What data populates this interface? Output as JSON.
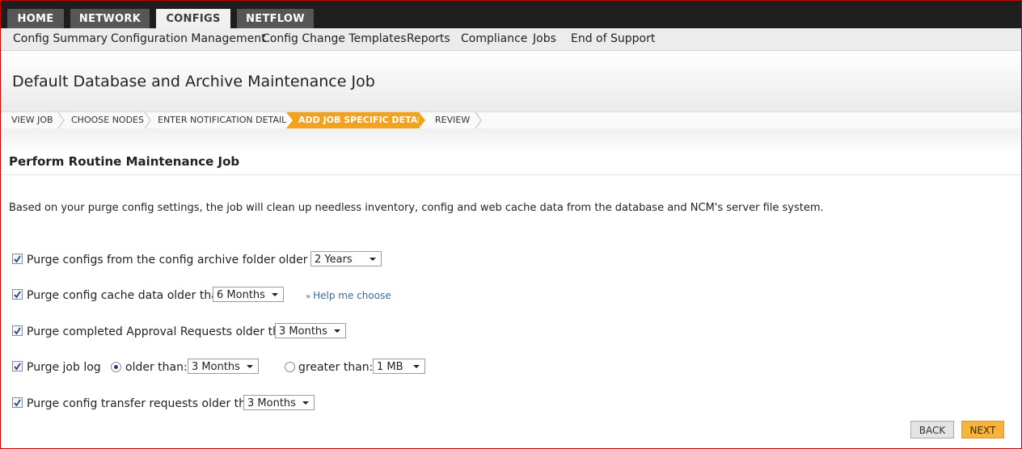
{
  "top_tabs": [
    {
      "label": "HOME",
      "active": false
    },
    {
      "label": "NETWORK",
      "active": false
    },
    {
      "label": "CONFIGS",
      "active": true
    },
    {
      "label": "NETFLOW",
      "active": false
    }
  ],
  "sub_nav": [
    "Config Summary",
    "Configuration Management",
    "Config Change Templates",
    "Reports",
    "Compliance",
    "Jobs",
    "End of Support"
  ],
  "page_title": "Default Database and Archive Maintenance Job",
  "steps": [
    {
      "label": "VIEW JOB",
      "active": false
    },
    {
      "label": "CHOOSE NODES",
      "active": false
    },
    {
      "label": "ENTER NOTIFICATION DETAILS",
      "active": false
    },
    {
      "label": "ADD JOB SPECIFIC DETAILS",
      "active": true
    },
    {
      "label": "REVIEW",
      "active": false
    }
  ],
  "section_title": "Perform Routine Maintenance Job",
  "description": "Based on your purge config settings, the job will clean up needless inventory, config and web cache data from the database and NCM's server file system.",
  "options": {
    "archive": {
      "label": "Purge configs from the config archive folder older than:",
      "value": "2 Years",
      "checked": true
    },
    "cache": {
      "label": "Purge config cache data older than:",
      "value": "6 Months",
      "checked": true,
      "help": "Help me choose"
    },
    "approval": {
      "label": "Purge completed Approval Requests older than:",
      "value": "3 Months",
      "checked": true
    },
    "joblog": {
      "label": "Purge job log",
      "checked": true,
      "older_label": "older than:",
      "older_value": "3 Months",
      "older_selected": true,
      "greater_label": "greater than:",
      "greater_value": "1 MB",
      "greater_selected": false
    },
    "transfer": {
      "label": "Purge config transfer requests older than:",
      "value": "3 Months",
      "checked": true
    }
  },
  "buttons": {
    "back": "BACK",
    "next": "NEXT"
  },
  "colors": {
    "accent": "#f4a21e",
    "topbar": "#1e1e1e",
    "link": "#3b6b9a",
    "border": "#cc0000"
  }
}
